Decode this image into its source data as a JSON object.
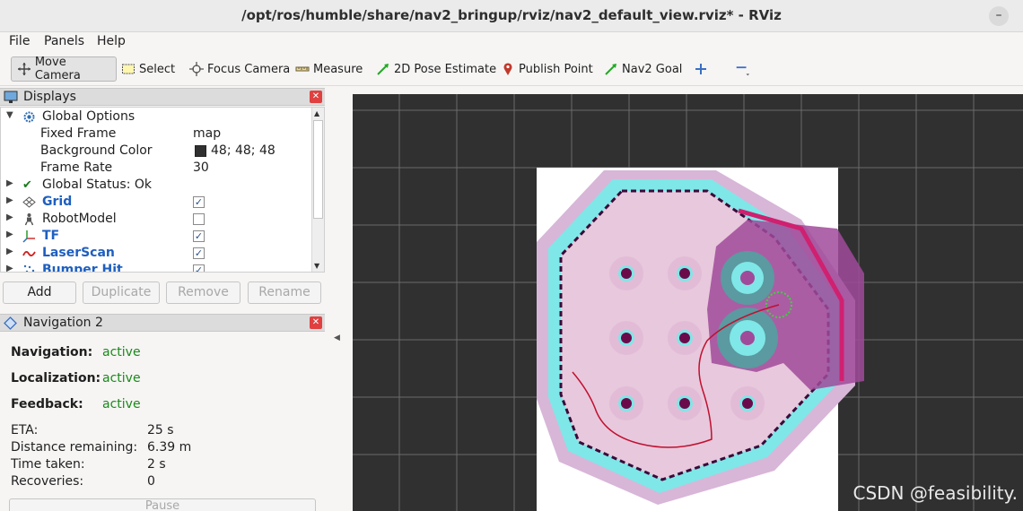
{
  "window": {
    "title": "/opt/ros/humble/share/nav2_bringup/rviz/nav2_default_view.rviz* - RViz",
    "minimize": "–"
  },
  "menu": {
    "file": "File",
    "panels": "Panels",
    "help": "Help"
  },
  "toolbar": {
    "move_camera": "Move Camera",
    "select": "Select",
    "focus_camera": "Focus Camera",
    "measure": "Measure",
    "pose_estimate": "2D Pose Estimate",
    "publish_point": "Publish Point",
    "nav2_goal": "Nav2 Goal"
  },
  "displays": {
    "title": "Displays",
    "global_options": "Global Options",
    "fixed_frame_label": "Fixed Frame",
    "fixed_frame": "map",
    "background_color_label": "Background Color",
    "background_color": "48; 48; 48",
    "background_swatch": "#303030",
    "frame_rate_label": "Frame Rate",
    "frame_rate": "30",
    "global_status": "Global Status: Ok",
    "items": [
      {
        "label": "Grid",
        "checked": "✓"
      },
      {
        "label": "RobotModel",
        "checked": ""
      },
      {
        "label": "TF",
        "checked": "✓"
      },
      {
        "label": "LaserScan",
        "checked": "✓"
      },
      {
        "label": "Bumper Hit",
        "checked": "✓"
      }
    ],
    "buttons": {
      "add": "Add",
      "duplicate": "Duplicate",
      "remove": "Remove",
      "rename": "Rename"
    }
  },
  "navigation": {
    "title": "Navigation 2",
    "navigation_label": "Navigation:",
    "navigation_value": "active",
    "localization_label": "Localization:",
    "localization_value": "active",
    "feedback_label": "Feedback:",
    "feedback_value": "active",
    "eta_label": "ETA:",
    "eta_value": "25 s",
    "distance_label": "Distance remaining:",
    "distance_value": "6.39 m",
    "time_label": "Time taken:",
    "time_value": "2 s",
    "recoveries_label": "Recoveries:",
    "recoveries_value": "0",
    "pause": "Pause"
  },
  "watermark": "CSDN @feasibility."
}
